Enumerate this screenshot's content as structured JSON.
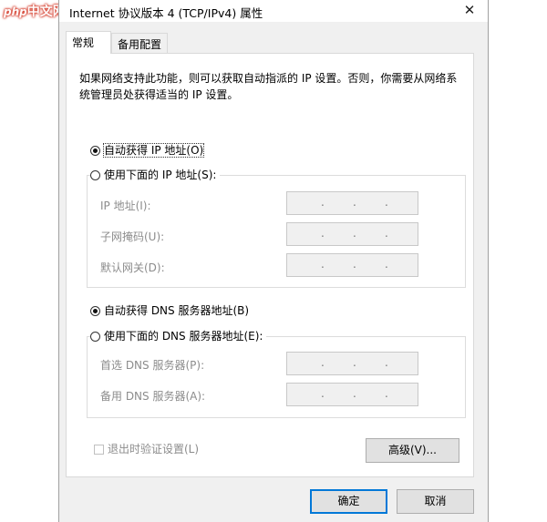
{
  "watermark": {
    "php": "php",
    "text": "中文网"
  },
  "window": {
    "title": "Internet 协议版本 4 (TCP/IPv4) 属性",
    "close_glyph": "✕"
  },
  "tabs": [
    {
      "label": "常规",
      "active": true
    },
    {
      "label": "备用配置",
      "active": false
    }
  ],
  "description": "如果网络支持此功能，则可以获取自动指派的 IP 设置。否则，你需要从网络系统管理员处获得适当的 IP 设置。",
  "ip": {
    "auto_label": "自动获得 IP 地址(O)",
    "manual_label": "使用下面的 IP 地址(S):",
    "selected": "auto",
    "fields": [
      {
        "label": "IP 地址(I):",
        "value": ". . ."
      },
      {
        "label": "子网掩码(U):",
        "value": ". . ."
      },
      {
        "label": "默认网关(D):",
        "value": ". . ."
      }
    ]
  },
  "dns": {
    "auto_label": "自动获得 DNS 服务器地址(B)",
    "manual_label": "使用下面的 DNS 服务器地址(E):",
    "selected": "auto",
    "fields": [
      {
        "label": "首选 DNS 服务器(P):",
        "value": ". . ."
      },
      {
        "label": "备用 DNS 服务器(A):",
        "value": ". . ."
      }
    ]
  },
  "validate": {
    "label": "退出时验证设置(L)",
    "checked": false
  },
  "buttons": {
    "advanced": "高级(V)...",
    "ok": "确定",
    "cancel": "取消"
  },
  "colors": {
    "accent": "#0078d7",
    "disabled_text": "#8c8c8c",
    "dialog_bg": "#f0f0f0"
  }
}
